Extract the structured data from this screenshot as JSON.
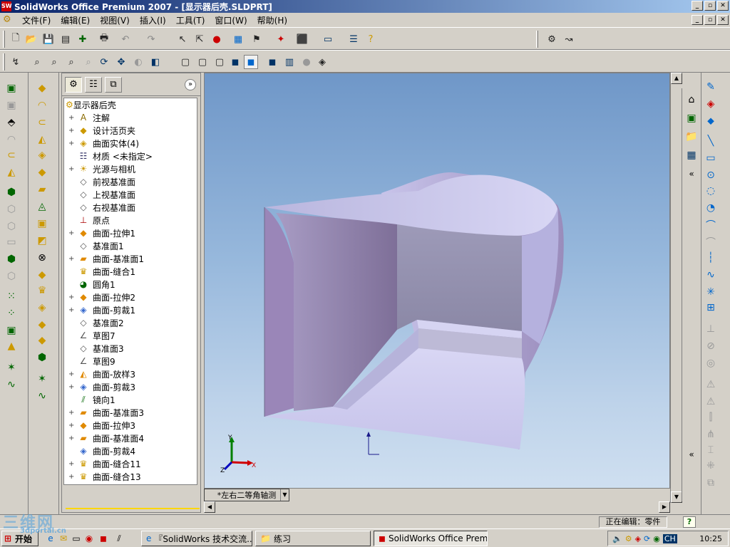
{
  "window": {
    "title": "SolidWorks Office Premium 2007 - [显示器后壳.SLDPRT]",
    "min": "_",
    "restore": "▫",
    "close": "✕"
  },
  "menu": [
    "文件(F)",
    "编辑(E)",
    "视图(V)",
    "插入(I)",
    "工具(T)",
    "窗口(W)",
    "帮助(H)"
  ],
  "feature_manager": {
    "root": "显示器后壳",
    "items": [
      {
        "label": "注解",
        "icon": "annotation-icon",
        "expand": true
      },
      {
        "label": "设计活页夹",
        "icon": "design-binder-icon",
        "expand": true
      },
      {
        "label": "曲面实体(4)",
        "icon": "surface-bodies-icon",
        "expand": true
      },
      {
        "label": "材质 <未指定>",
        "icon": "material-icon",
        "expand": false
      },
      {
        "label": "光源与相机",
        "icon": "lights-icon",
        "expand": true
      },
      {
        "label": "前视基准面",
        "icon": "plane-icon",
        "expand": false
      },
      {
        "label": "上视基准面",
        "icon": "plane-icon",
        "expand": false
      },
      {
        "label": "右视基准面",
        "icon": "plane-icon",
        "expand": false
      },
      {
        "label": "原点",
        "icon": "origin-icon",
        "expand": false
      },
      {
        "label": "曲面-拉伸1",
        "icon": "extrude-surface-icon",
        "expand": true
      },
      {
        "label": "基准面1",
        "icon": "plane-icon",
        "expand": false
      },
      {
        "label": "曲面-基准面1",
        "icon": "planar-surface-icon",
        "expand": true
      },
      {
        "label": "曲面-缝合1",
        "icon": "knit-icon",
        "expand": false
      },
      {
        "label": "圆角1",
        "icon": "fillet-icon",
        "expand": false
      },
      {
        "label": "曲面-拉伸2",
        "icon": "extrude-surface-icon",
        "expand": true
      },
      {
        "label": "曲面-剪裁1",
        "icon": "trim-surface-icon",
        "expand": true
      },
      {
        "label": "基准面2",
        "icon": "plane-icon",
        "expand": false
      },
      {
        "label": "草图7",
        "icon": "sketch-icon",
        "expand": false
      },
      {
        "label": "基准面3",
        "icon": "plane-icon",
        "expand": false
      },
      {
        "label": "草图9",
        "icon": "sketch-icon",
        "expand": false
      },
      {
        "label": "曲面-放样3",
        "icon": "loft-surface-icon",
        "expand": true
      },
      {
        "label": "曲面-剪裁3",
        "icon": "trim-surface-icon",
        "expand": true
      },
      {
        "label": "镜向1",
        "icon": "mirror-icon",
        "expand": false
      },
      {
        "label": "曲面-基准面3",
        "icon": "planar-surface-icon",
        "expand": true
      },
      {
        "label": "曲面-拉伸3",
        "icon": "extrude-surface-icon",
        "expand": true
      },
      {
        "label": "曲面-基准面4",
        "icon": "planar-surface-icon",
        "expand": true
      },
      {
        "label": "曲面-剪裁4",
        "icon": "trim-surface-icon",
        "expand": false
      },
      {
        "label": "曲面-缝合11",
        "icon": "knit-icon",
        "expand": true
      },
      {
        "label": "曲面-缝合13",
        "icon": "knit-icon",
        "expand": true
      }
    ]
  },
  "viewport": {
    "view_name": "*左右二等角轴测",
    "axis_x": "X",
    "axis_y": "Y",
    "axis_z": "Z"
  },
  "status": {
    "editing": "正在编辑：零件",
    "help": "?"
  },
  "taskbar": {
    "start": "开始",
    "tasks": [
      "『SolidWorks 技术交流...",
      "练习",
      "SolidWorks Office Premiu..."
    ],
    "lang": "CH",
    "clock": "10:25"
  },
  "watermark": {
    "main": "三维网",
    "sub": "3dportal.cn"
  },
  "colors": {
    "title_start": "#0a246a",
    "title_end": "#a6caf0",
    "model_face": "#c9c6ea",
    "viewport_top": "#6f97c8"
  }
}
